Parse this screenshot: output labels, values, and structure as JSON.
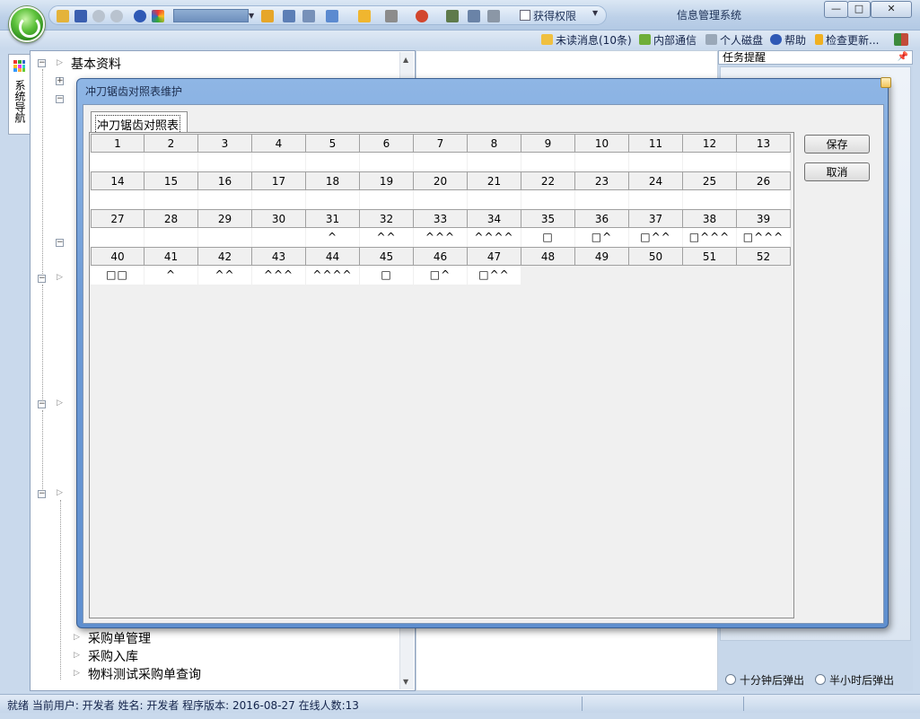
{
  "window": {
    "title": "信息管理系统",
    "permission_label": "获得权限"
  },
  "info_bar": {
    "unread": "未读消息(10条)",
    "internal_comm": "内部通信",
    "personal_disk": "个人磁盘",
    "help": "帮助",
    "check_update": "检查更新..."
  },
  "nav": {
    "tab_label": "系统导航",
    "root_label": "基本资料",
    "items": [
      "采购单管理",
      "采购入库",
      "物料测试采购单查询"
    ]
  },
  "task_panel": {
    "title": "任务提醒",
    "option_ten_min": "十分钟后弹出",
    "option_half_hour": "半小时后弹出"
  },
  "status_bar": {
    "text": "就绪  当前用户: 开发者  姓名: 开发者  程序版本: 2016-08-27  在线人数:13"
  },
  "dialog": {
    "title": "冲刀锯齿对照表维护",
    "tab_label": "冲刀锯齿对照表",
    "save_label": "保存",
    "cancel_label": "取消",
    "rows": [
      {
        "headers": [
          "1",
          "2",
          "3",
          "4",
          "5",
          "6",
          "7",
          "8",
          "9",
          "10",
          "11",
          "12",
          "13"
        ],
        "values": [
          "",
          "",
          "",
          "",
          "",
          "",
          "",
          "",
          "",
          "",
          "",
          "",
          ""
        ]
      },
      {
        "headers": [
          "14",
          "15",
          "16",
          "17",
          "18",
          "19",
          "20",
          "21",
          "22",
          "23",
          "24",
          "25",
          "26"
        ],
        "values": [
          "",
          "",
          "",
          "",
          "",
          "",
          "",
          "",
          "",
          "",
          "",
          "",
          ""
        ]
      },
      {
        "headers": [
          "27",
          "28",
          "29",
          "30",
          "31",
          "32",
          "33",
          "34",
          "35",
          "36",
          "37",
          "38",
          "39"
        ],
        "values": [
          "",
          "",
          "",
          "",
          "^",
          "^^",
          "^^^",
          "^^^^",
          "□",
          "□^",
          "□^^",
          "□^^^",
          "□^^^"
        ]
      },
      {
        "headers": [
          "40",
          "41",
          "42",
          "43",
          "44",
          "45",
          "46",
          "47",
          "48",
          "49",
          "50",
          "51",
          "52"
        ],
        "values": [
          "□□",
          "^",
          "^^",
          "^^^",
          "^^^^",
          "□",
          "□^",
          "□^^",
          "",
          "",
          "",
          "",
          ""
        ]
      }
    ]
  }
}
